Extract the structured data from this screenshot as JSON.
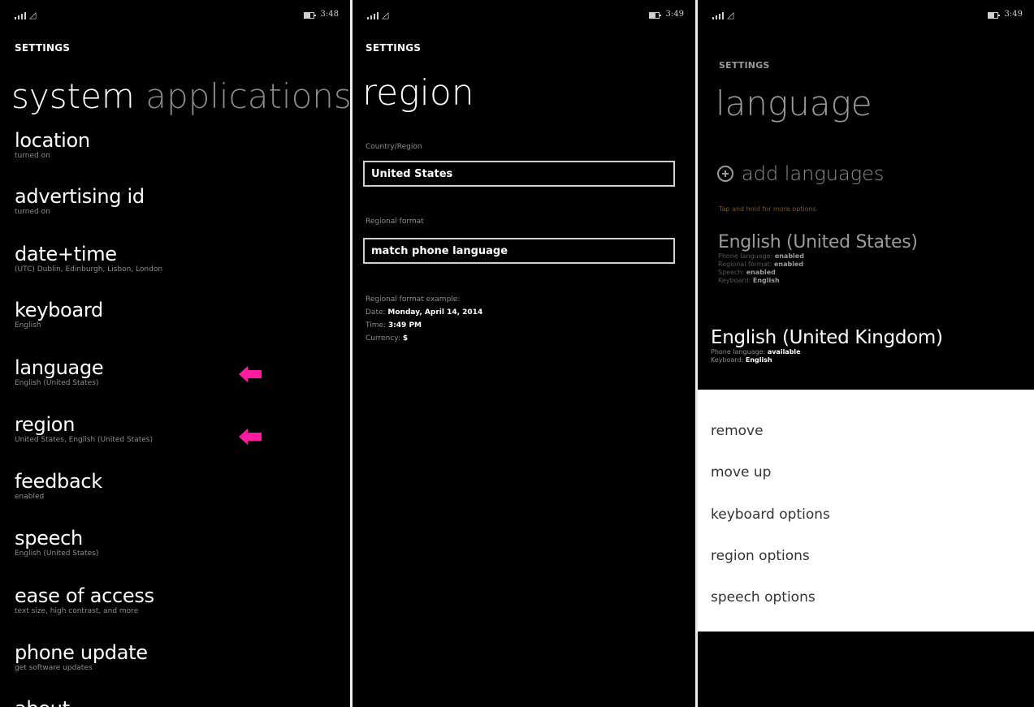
{
  "screen1": {
    "status": {
      "time": "3:48"
    },
    "app_title": "SETTINGS",
    "pivot_active": "system",
    "pivot_next": "applications",
    "items": [
      {
        "title": "location",
        "subtitle": "turned on"
      },
      {
        "title": "advertising id",
        "subtitle": "turned on"
      },
      {
        "title": "date+time",
        "subtitle": "(UTC) Dublin, Edinburgh, Lisbon, London"
      },
      {
        "title": "keyboard",
        "subtitle": "English"
      },
      {
        "title": "language",
        "subtitle": "English (United States)"
      },
      {
        "title": "region",
        "subtitle": "United States, English (United States)"
      },
      {
        "title": "feedback",
        "subtitle": "enabled"
      },
      {
        "title": "speech",
        "subtitle": "English (United States)"
      },
      {
        "title": "ease of access",
        "subtitle": "text size, high contrast, and more"
      },
      {
        "title": "phone update",
        "subtitle": "get software updates"
      },
      {
        "title": "about",
        "subtitle": ""
      }
    ],
    "arrow_color": "#ff1aa0"
  },
  "screen2": {
    "status": {
      "time": "3:49"
    },
    "app_title": "SETTINGS",
    "page_title": "region",
    "country_label": "Country/Region",
    "country_value": "United States",
    "format_label": "Regional format",
    "format_value": "match phone language",
    "example_label": "Regional format example:",
    "date_label": "Date:",
    "date_value": "Monday, April 14, 2014",
    "time_label": "Time:",
    "time_value": "3:49 PM",
    "currency_label": "Currency:",
    "currency_value": "$"
  },
  "screen3": {
    "status": {
      "time": "3:49"
    },
    "app_title": "SETTINGS",
    "page_title": "language",
    "add_label": "add languages",
    "hint": "Tap and hold for more options",
    "languages": [
      {
        "name": "English (United States)",
        "details": [
          {
            "label": "Phone language:",
            "value": "enabled"
          },
          {
            "label": "Regional format:",
            "value": "enabled"
          },
          {
            "label": "Speech:",
            "value": "enabled"
          },
          {
            "label": "Keyboard:",
            "value": "English"
          }
        ]
      },
      {
        "name": "English (United Kingdom)",
        "details": [
          {
            "label": "Phone language:",
            "value": "available"
          },
          {
            "label": "Keyboard:",
            "value": "English"
          }
        ]
      }
    ],
    "menu": [
      "remove",
      "move up",
      "keyboard options",
      "region options",
      "speech options"
    ],
    "accent": "#c09030"
  }
}
